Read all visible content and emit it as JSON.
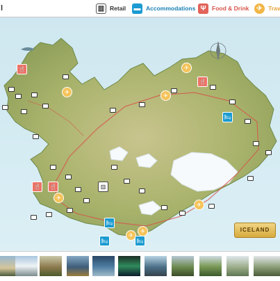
{
  "header": {
    "title_fragment": "l",
    "legend": [
      {
        "label": "Retail",
        "icon": "shopping-bag-icon",
        "color": "#333333"
      },
      {
        "label": "Accommodations",
        "icon": "bed-icon",
        "color": "#1b9bd1"
      },
      {
        "label": "Food & Drink",
        "icon": "fork-knife-icon",
        "color": "#e2635a"
      },
      {
        "label": "Trav",
        "icon": "travel-icon",
        "color": "#f2b545"
      }
    ]
  },
  "map": {
    "badge": "ICELAND",
    "markers": {
      "food": {
        "icon": "fork-knife-icon",
        "glyph": "🍴"
      },
      "travel": {
        "icon": "travel-icon",
        "glyph": "✈"
      },
      "accommodation": {
        "icon": "bed-icon",
        "glyph": "🛏"
      },
      "retail": {
        "icon": "shopping-bag-icon",
        "glyph": "▥"
      }
    }
  },
  "thumbnails": {
    "count": 11
  }
}
